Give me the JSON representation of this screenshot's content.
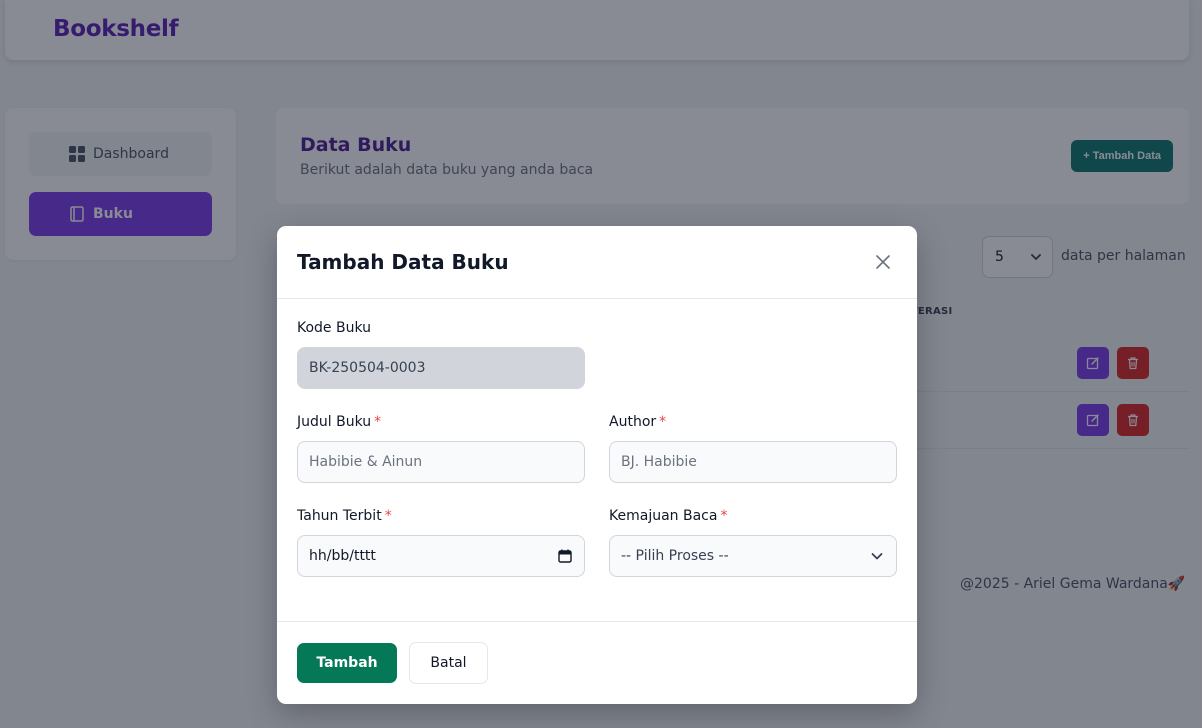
{
  "app": {
    "brand": "Bookshelf"
  },
  "sidebar": {
    "items": [
      {
        "label": "Dashboard",
        "icon": "grid-icon",
        "active": false
      },
      {
        "label": "Buku",
        "icon": "book-icon",
        "active": true
      }
    ]
  },
  "header": {
    "title": "Data Buku",
    "subtitle": "Berikut adalah data buku yang anda baca",
    "add_button": "+ Tambah Data"
  },
  "table": {
    "per_page_value": "5",
    "per_page_label": "data per halaman",
    "visible_column_header": "LITERASI"
  },
  "footer": {
    "text": "@2025 - Ariel Gema Wardana🚀"
  },
  "modal": {
    "title": "Tambah Data Buku",
    "fields": {
      "kode": {
        "label": "Kode Buku",
        "value": "BK-250504-0003"
      },
      "judul": {
        "label": "Judul Buku",
        "placeholder": "Habibie & Ainun",
        "required": "*"
      },
      "author": {
        "label": "Author",
        "placeholder": "BJ. Habibie",
        "required": "*"
      },
      "tahun": {
        "label": "Tahun Terbit",
        "placeholder": "hh/bb/tttt",
        "required": "*"
      },
      "kemajuan": {
        "label": "Kemajuan Baca",
        "selected": "-- Pilih Proses --",
        "required": "*"
      }
    },
    "submit_label": "Tambah",
    "cancel_label": "Batal"
  },
  "colors": {
    "brand": "#5b21b6",
    "primary": "#7c3aed",
    "success": "#047857",
    "danger": "#dc2626",
    "teal": "#0f766e"
  }
}
